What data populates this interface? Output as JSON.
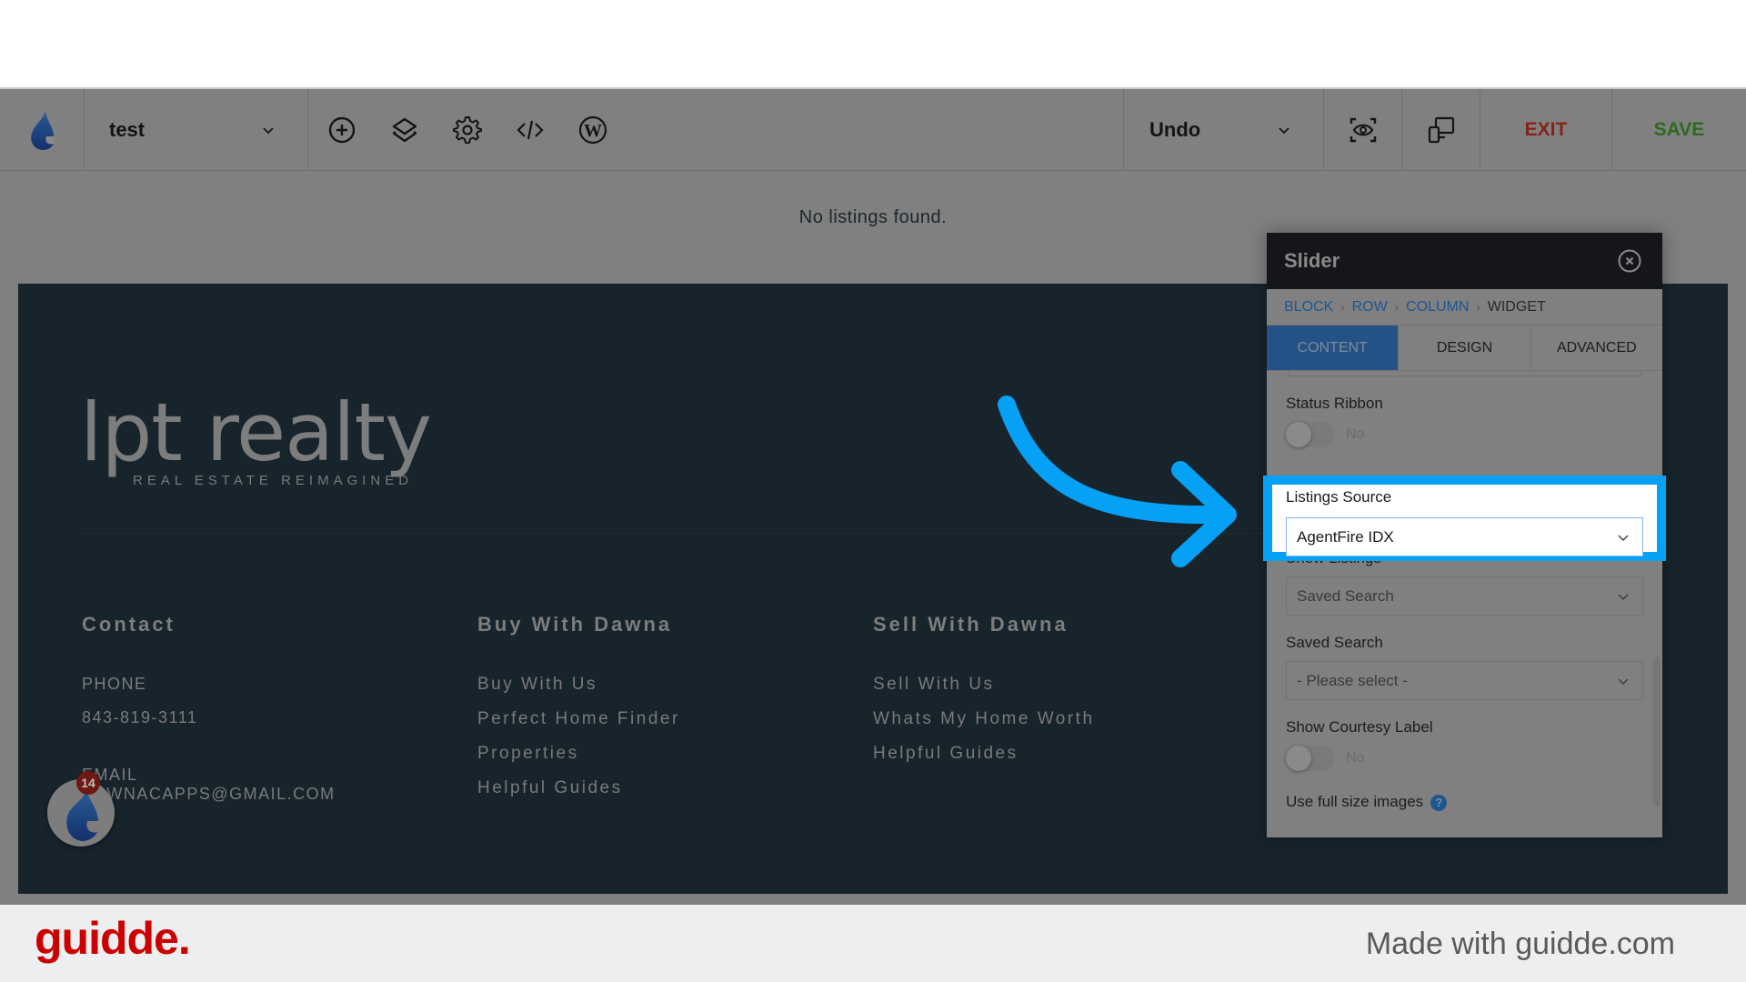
{
  "toolbar": {
    "logo_icon": "flame-logo-icon",
    "page_selector": "test",
    "icons": [
      "add-circle-icon",
      "layers-icon",
      "gear-icon",
      "code-icon",
      "wordpress-icon"
    ],
    "undo_label": "Undo",
    "preview_icon": "preview-eye-icon",
    "responsive_icon": "responsive-devices-icon",
    "exit_label": "EXIT",
    "save_label": "SAVE",
    "colors": {
      "exit": "#862219",
      "save": "#2e6a1e"
    }
  },
  "canvas": {
    "empty_message": "No listings found."
  },
  "site_footer": {
    "brand_name": "lpt realty",
    "brand_tagline": "REAL ESTATE REIMAGINED",
    "contact": {
      "heading": "Contact",
      "phone_label": "PHONE",
      "phone_value": "843-819-3111",
      "email_label": "EMAIL",
      "email_value": "DAWNACAPPS@GMAIL.COM"
    },
    "buy": {
      "heading": "Buy With Dawna",
      "links": [
        "Buy With Us",
        "Perfect Home Finder",
        "Properties",
        "Helpful Guides"
      ]
    },
    "sell": {
      "heading": "Sell With Dawna",
      "links": [
        "Sell With Us",
        "Whats My Home Worth",
        "Helpful Guides"
      ]
    },
    "chat_badge_count": "14"
  },
  "panel": {
    "title": "Slider",
    "breadcrumbs": [
      "BLOCK",
      "ROW",
      "COLUMN",
      "WIDGET"
    ],
    "tabs": [
      "CONTENT",
      "DESIGN",
      "ADVANCED"
    ],
    "active_tab": "CONTENT",
    "fields": {
      "status_ribbon": {
        "label": "Status Ribbon",
        "value": "No"
      },
      "listings_source": {
        "label": "Listings Source",
        "value": "AgentFire IDX"
      },
      "show_listings": {
        "label": "Show Listings",
        "value": "Saved Search"
      },
      "saved_search": {
        "label": "Saved Search",
        "value": "- Please select -"
      },
      "show_courtesy_label": {
        "label": "Show Courtesy Label",
        "value": "No"
      },
      "use_full_size_images": {
        "label": "Use full size images",
        "help": "?"
      }
    }
  },
  "annotation": {
    "highlight_color": "#06a0f5"
  },
  "guidde": {
    "logo": "guidde.",
    "made_with": "Made with guidde.com"
  }
}
